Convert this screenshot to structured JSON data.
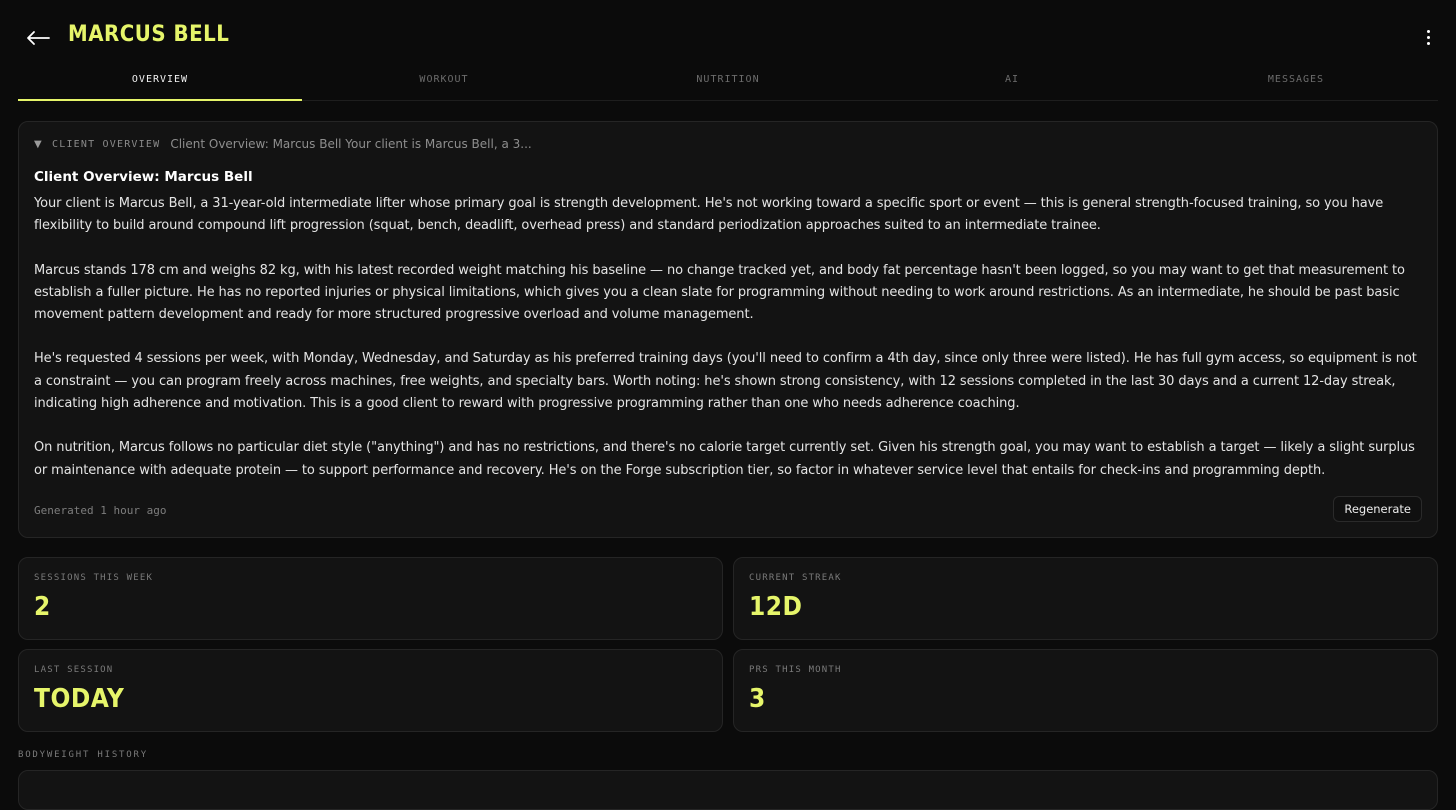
{
  "header": {
    "title": "MARCUS BELL"
  },
  "tabs": [
    {
      "label": "OVERVIEW",
      "active": true
    },
    {
      "label": "WORKOUT",
      "active": false
    },
    {
      "label": "NUTRITION",
      "active": false
    },
    {
      "label": "AI",
      "active": false
    },
    {
      "label": "MESSAGES",
      "active": false
    }
  ],
  "overview": {
    "section_label": "CLIENT OVERVIEW",
    "preview": "Client Overview: Marcus Bell Your client is Marcus Bell, a 3...",
    "heading": "Client Overview: Marcus Bell",
    "paragraphs": [
      "Your client is Marcus Bell, a 31-year-old intermediate lifter whose primary goal is strength development. He's not working toward a specific sport or event — this is general strength-focused training, so you have flexibility to build around compound lift progression (squat, bench, deadlift, overhead press) and standard periodization approaches suited to an intermediate trainee.",
      "Marcus stands 178 cm and weighs 82 kg, with his latest recorded weight matching his baseline — no change tracked yet, and body fat percentage hasn't been logged, so you may want to get that measurement to establish a fuller picture. He has no reported injuries or physical limitations, which gives you a clean slate for programming without needing to work around restrictions. As an intermediate, he should be past basic movement pattern development and ready for more structured progressive overload and volume management.",
      "He's requested 4 sessions per week, with Monday, Wednesday, and Saturday as his preferred training days (you'll need to confirm a 4th day, since only three were listed). He has full gym access, so equipment is not a constraint — you can program freely across machines, free weights, and specialty bars. Worth noting: he's shown strong consistency, with 12 sessions completed in the last 30 days and a current 12-day streak, indicating high adherence and motivation. This is a good client to reward with progressive programming rather than one who needs adherence coaching.",
      "On nutrition, Marcus follows no particular diet style (\"anything\") and has no restrictions, and there's no calorie target currently set. Given his strength goal, you may want to establish a target — likely a slight surplus or maintenance with adequate protein — to support performance and recovery. He's on the Forge subscription tier, so factor in whatever service level that entails for check-ins and programming depth."
    ],
    "generated": "Generated 1 hour ago",
    "regenerate_label": "Regenerate"
  },
  "stats": {
    "sessions_label": "SESSIONS THIS WEEK",
    "sessions_value": "2",
    "streak_label": "CURRENT STREAK",
    "streak_value": "12D",
    "last_session_label": "LAST SESSION",
    "last_session_value": "TODAY",
    "prs_label": "PRS THIS MONTH",
    "prs_value": "3"
  },
  "bodyweight": {
    "section_label": "BODYWEIGHT HISTORY"
  },
  "colors": {
    "accent": "#e6f56a",
    "background": "#0b0b0b",
    "card": "#131313"
  }
}
